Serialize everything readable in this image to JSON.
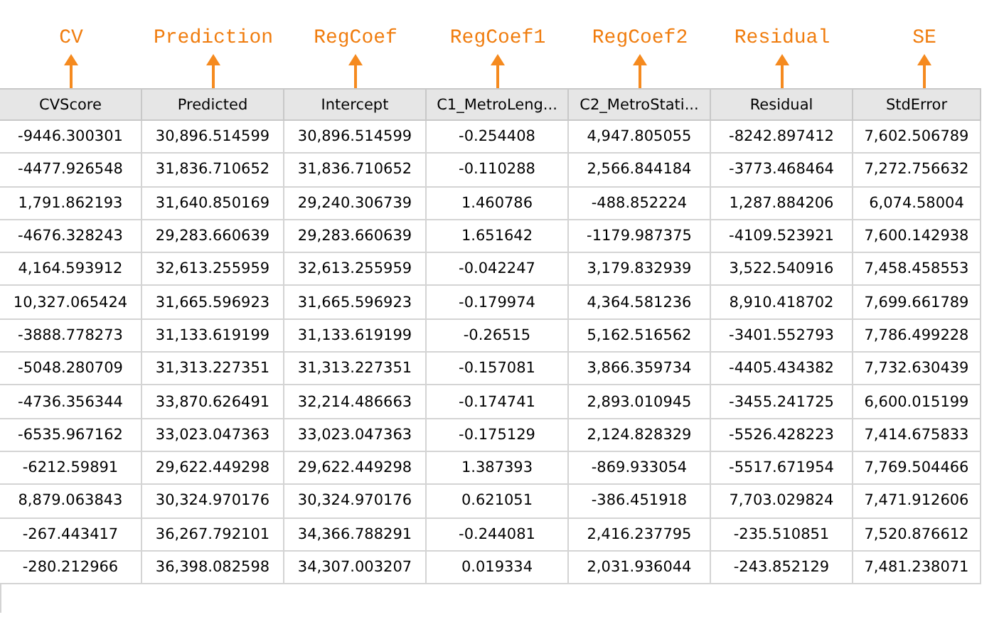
{
  "annotations": [
    "CV",
    "Prediction",
    "RegCoef",
    "RegCoef1",
    "RegCoef2",
    "Residual",
    "SE"
  ],
  "table": {
    "columns": [
      "CVScore",
      "Predicted",
      "Intercept",
      "C1_MetroLeng...",
      "C2_MetroStati...",
      "Residual",
      "StdError"
    ],
    "rows": [
      [
        "-9446.300301",
        "30,896.514599",
        "30,896.514599",
        "-0.254408",
        "4,947.805055",
        "-8242.897412",
        "7,602.506789"
      ],
      [
        "-4477.926548",
        "31,836.710652",
        "31,836.710652",
        "-0.110288",
        "2,566.844184",
        "-3773.468464",
        "7,272.756632"
      ],
      [
        "1,791.862193",
        "31,640.850169",
        "29,240.306739",
        "1.460786",
        "-488.852224",
        "1,287.884206",
        "6,074.58004"
      ],
      [
        "-4676.328243",
        "29,283.660639",
        "29,283.660639",
        "1.651642",
        "-1179.987375",
        "-4109.523921",
        "7,600.142938"
      ],
      [
        "4,164.593912",
        "32,613.255959",
        "32,613.255959",
        "-0.042247",
        "3,179.832939",
        "3,522.540916",
        "7,458.458553"
      ],
      [
        "10,327.065424",
        "31,665.596923",
        "31,665.596923",
        "-0.179974",
        "4,364.581236",
        "8,910.418702",
        "7,699.661789"
      ],
      [
        "-3888.778273",
        "31,133.619199",
        "31,133.619199",
        "-0.26515",
        "5,162.516562",
        "-3401.552793",
        "7,786.499228"
      ],
      [
        "-5048.280709",
        "31,313.227351",
        "31,313.227351",
        "-0.157081",
        "3,866.359734",
        "-4405.434382",
        "7,732.630439"
      ],
      [
        "-4736.356344",
        "33,870.626491",
        "32,214.486663",
        "-0.174741",
        "2,893.010945",
        "-3455.241725",
        "6,600.015199"
      ],
      [
        "-6535.967162",
        "33,023.047363",
        "33,023.047363",
        "-0.175129",
        "2,124.828329",
        "-5526.428223",
        "7,414.675833"
      ],
      [
        "-6212.59891",
        "29,622.449298",
        "29,622.449298",
        "1.387393",
        "-869.933054",
        "-5517.671954",
        "7,769.504466"
      ],
      [
        "8,879.063843",
        "30,324.970176",
        "30,324.970176",
        "0.621051",
        "-386.451918",
        "7,703.029824",
        "7,471.912606"
      ],
      [
        "-267.443417",
        "36,267.792101",
        "34,366.788291",
        "-0.244081",
        "2,416.237795",
        "-235.510851",
        "7,520.876612"
      ],
      [
        "-280.212966",
        "36,398.082598",
        "34,307.003207",
        "0.019334",
        "2,031.936044",
        "-243.852129",
        "7,481.238071"
      ]
    ]
  }
}
